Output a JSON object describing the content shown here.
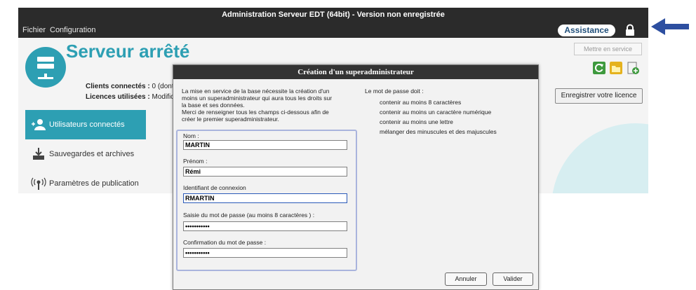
{
  "window": {
    "title": "Administration Serveur EDT (64bit) - Version non enregistrée"
  },
  "menu": {
    "items": [
      "Fichier",
      "Configuration"
    ]
  },
  "header": {
    "assist_label": "Assistance"
  },
  "icons": {
    "lock": "lock-icon",
    "arrow": "arrow-left-icon",
    "server": "server-icon"
  },
  "colors": {
    "accent": "#2d9fb3",
    "titlebar": "#2b2b2b",
    "arrow": "#2d4fa0"
  },
  "main": {
    "status_title": "Serveur arrêté",
    "clients_label": "Clients connectés :",
    "clients_value": "0 (dont",
    "licences_label": "Licences utilisées :",
    "licences_value": "Modific",
    "mettre_en_service": "Mettre en service",
    "register_licence": "Enregistrer votre licence"
  },
  "sidebar": {
    "items": [
      {
        "label": "Utilisateurs connectés",
        "icon": "users-icon",
        "active": true
      },
      {
        "label": "Sauvegardes et archives",
        "icon": "download-icon",
        "active": false
      },
      {
        "label": "Paramètres de publication",
        "icon": "broadcast-icon",
        "active": false
      }
    ]
  },
  "dialog": {
    "title": "Création d'un superadministrateur",
    "intro_lines": [
      "La mise en service de la base nécessite la création d'un",
      "moins un superadministrateur qui aura tous les droits sur",
      "la base et ses données.",
      "Merci de renseigner tous les champs ci-dessous afin de",
      "créer le premier superadministrateur."
    ],
    "rules_title": "Le mot de passe doit :",
    "rules": [
      "contenir au moins 8 caractères",
      "contenir au moins un caractère numérique",
      "contenir au moins une lettre",
      "mélanger des minuscules et des majuscules"
    ],
    "fields": {
      "nom_label": "Nom :",
      "nom_value": "MARTIN",
      "prenom_label": "Prénom :",
      "prenom_value": "Rémi",
      "login_label": "Identifiant de connexion",
      "login_value": "RMARTIN",
      "password_label": "Saisie du mot de passe (au moins 8 caractères ) :",
      "password_value": "•••••••••••",
      "confirm_label": "Confirmation du mot de passe :",
      "confirm_value": "•••••••••••"
    },
    "cancel_label": "Annuler",
    "ok_label": "Valider"
  }
}
